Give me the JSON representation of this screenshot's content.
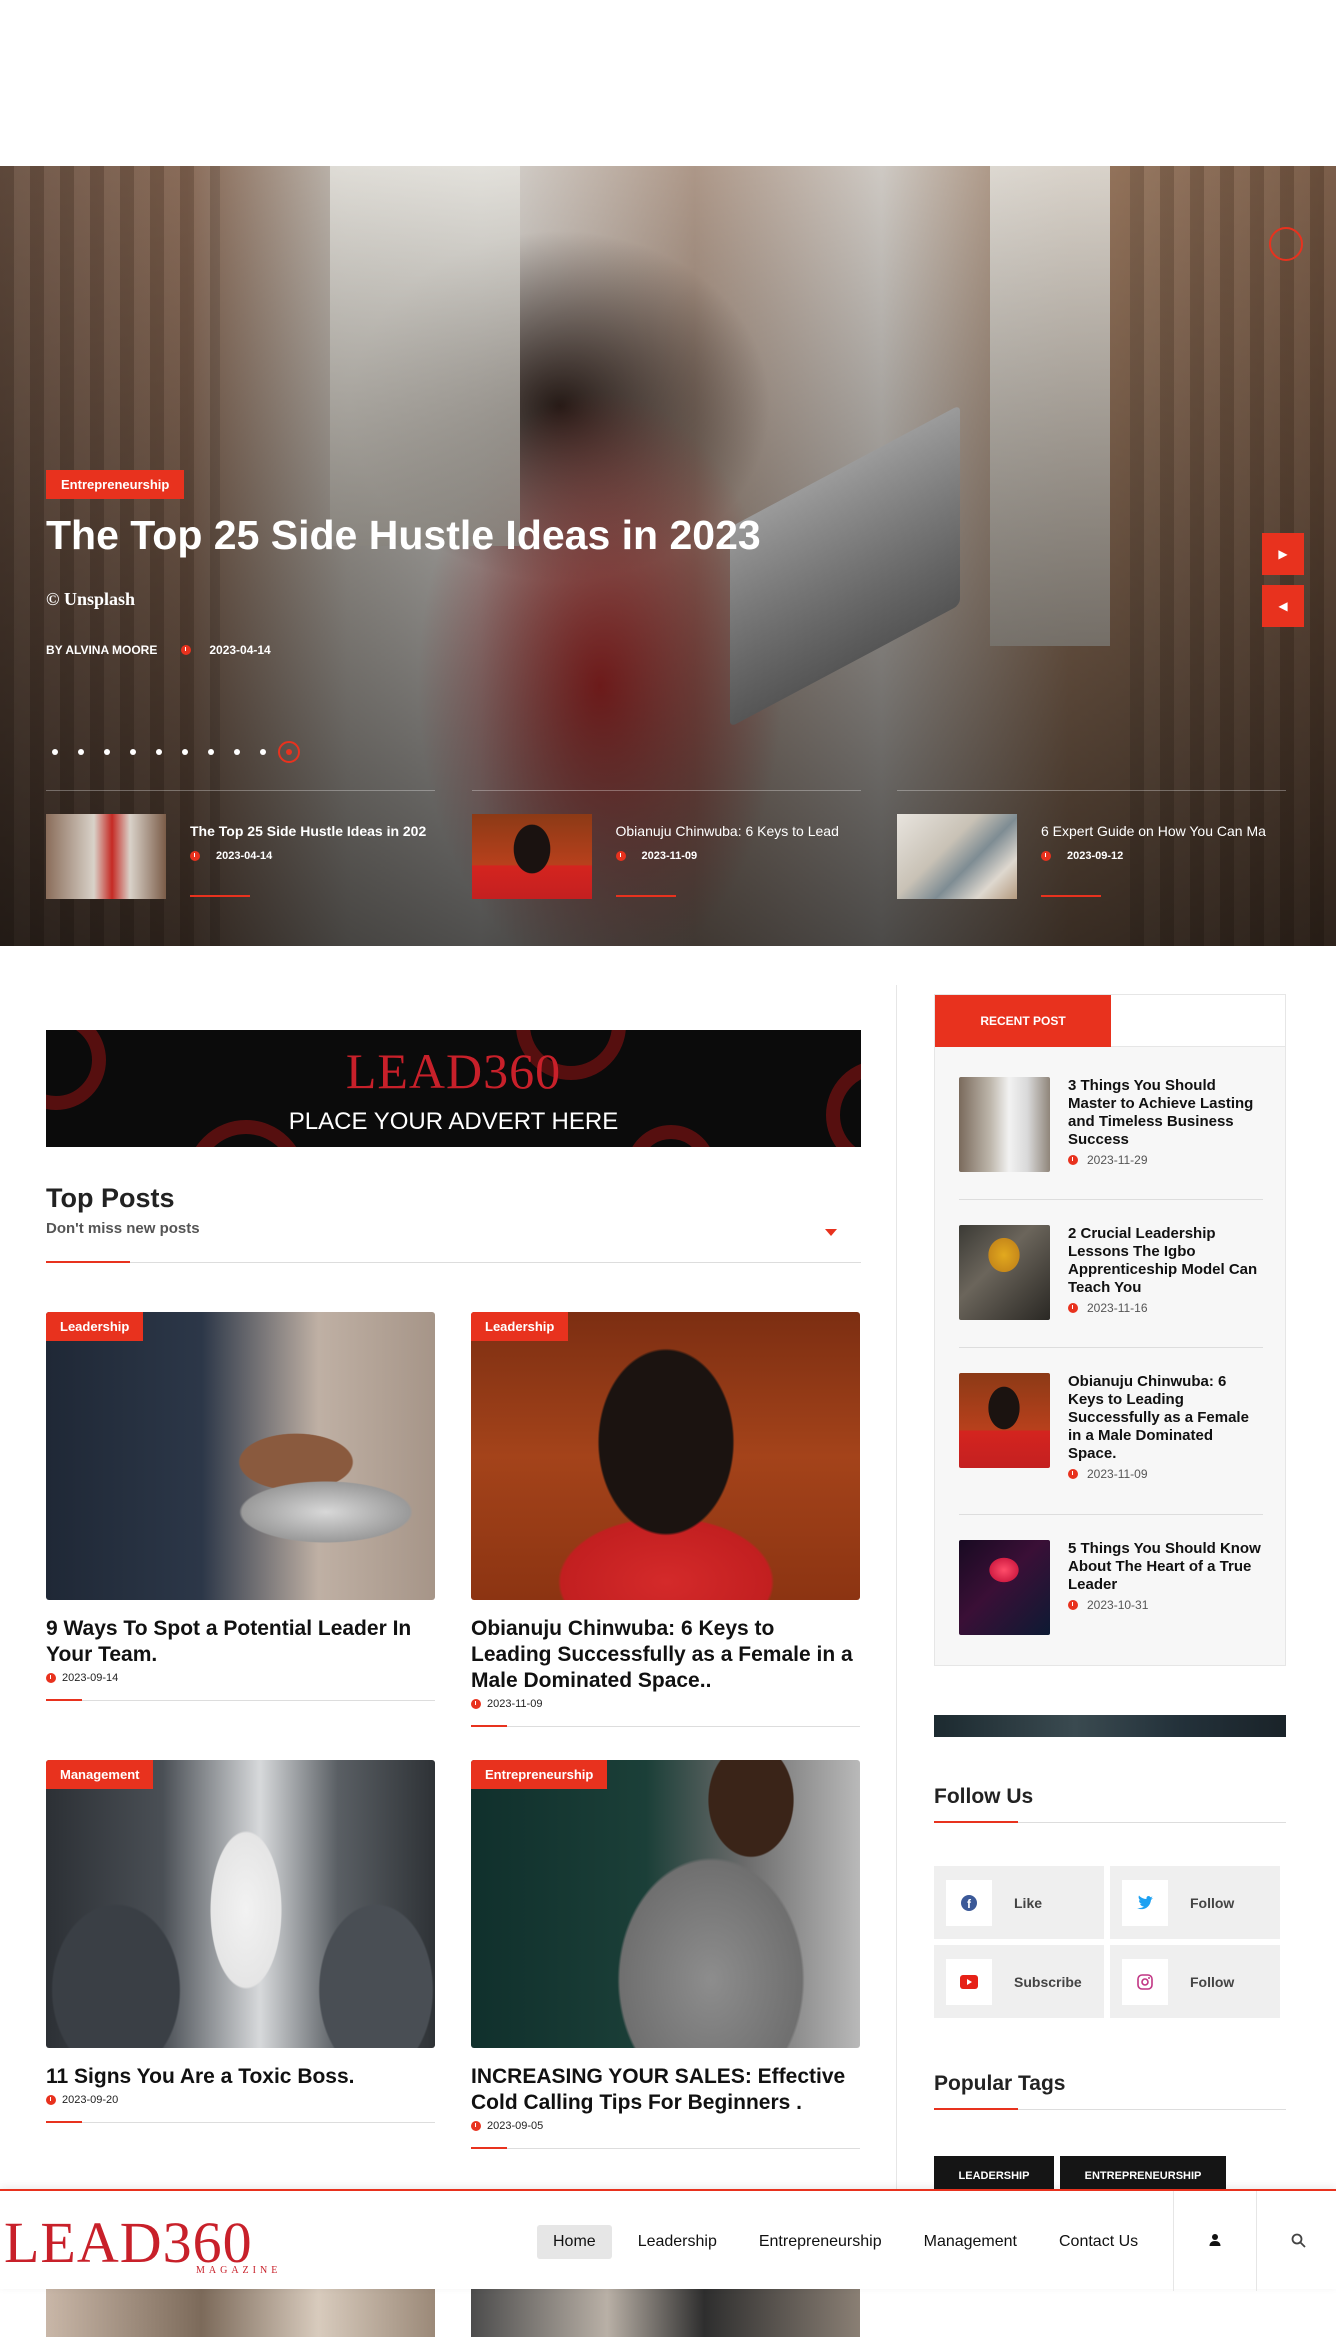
{
  "colors": {
    "accent": "#e8321e",
    "logo_red": "#c8202a",
    "dark": "#151515"
  },
  "hero": {
    "category": "Entrepreneurship",
    "title": "The Top 25 Side Hustle Ideas in 2023",
    "credit": "© Unsplash",
    "author": "BY ALVINA MOORE",
    "date": "2023-04-14",
    "slides_total": 10,
    "active_slide": 10,
    "next_icon": "caret-right-icon",
    "prev_icon": "caret-left-icon"
  },
  "slider_thumbs": [
    {
      "title": "The Top 25 Side Hustle Ideas in 202",
      "date": "2023-04-14"
    },
    {
      "title": "Obianuju Chinwuba: 6 Keys to Lead",
      "date": "2023-11-09"
    },
    {
      "title": "6 Expert Guide on How You Can Ma",
      "date": "2023-09-12"
    }
  ],
  "advert": {
    "logo": "LEAD360",
    "cta": "PLACE YOUR ADVERT HERE"
  },
  "top_posts": {
    "title": "Top Posts",
    "subtitle": "Don't miss new posts",
    "posts": [
      {
        "category": "Leadership",
        "title": "9 Ways To Spot a Potential Leader In Your Team.",
        "date": "2023-09-14"
      },
      {
        "category": "Leadership",
        "title": "Obianuju Chinwuba: 6 Keys to Leading Successfully as a Female in a Male Dominated Space..",
        "date": "2023-11-09"
      },
      {
        "category": "Management",
        "title": "11 Signs You Are a Toxic Boss.",
        "date": "2023-09-20"
      },
      {
        "category": "Entrepreneurship",
        "title": "INCREASING YOUR SALES: Effective Cold Calling Tips For Beginners .",
        "date": "2023-09-05"
      }
    ]
  },
  "recent_posts": {
    "tab_label": "RECENT POST",
    "items": [
      {
        "title": "3 Things You Should Master to Achieve Lasting and Timeless Business Success",
        "date": "2023-11-29"
      },
      {
        "title": "2 Crucial Leadership Lessons The Igbo Apprenticeship Model Can Teach You",
        "date": "2023-11-16"
      },
      {
        "title": "Obianuju Chinwuba: 6 Keys to Leading Successfully as a Female in a Male Dominated Space.",
        "date": "2023-11-09"
      },
      {
        "title": "5 Things You Should Know About The Heart of a True Leader",
        "date": "2023-10-31"
      }
    ]
  },
  "follow_us": {
    "title": "Follow Us",
    "items": [
      {
        "network": "facebook-icon",
        "label": "Like",
        "color": "#3b5998"
      },
      {
        "network": "twitter-icon",
        "label": "Follow",
        "color": "#1da1f2"
      },
      {
        "network": "youtube-icon",
        "label": "Subscribe",
        "color": "#e62117"
      },
      {
        "network": "instagram-icon",
        "label": "Follow",
        "color": "#c13584"
      }
    ]
  },
  "popular_tags": {
    "title": "Popular Tags",
    "tags": [
      "LEADERSHIP",
      "ENTREPRENEURSHIP"
    ]
  },
  "nav": {
    "logo": "LEAD360",
    "logo_sub": "MAGAZINE",
    "items": [
      "Home",
      "Leadership",
      "Entrepreneurship",
      "Management",
      "Contact Us"
    ],
    "active": "Home",
    "user_icon": "user-icon",
    "search_icon": "search-icon"
  }
}
